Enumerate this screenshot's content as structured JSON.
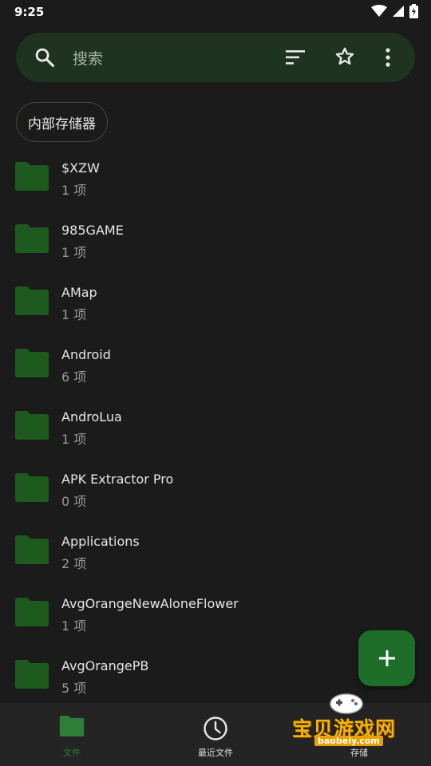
{
  "status_bar": {
    "time": "9:25"
  },
  "search": {
    "placeholder": "搜索"
  },
  "storage_chip": {
    "label": "内部存储器"
  },
  "files": [
    {
      "name": "$XZW",
      "count": "1 项"
    },
    {
      "name": "985GAME",
      "count": "1 项"
    },
    {
      "name": "AMap",
      "count": "1 项"
    },
    {
      "name": "Android",
      "count": "6 项"
    },
    {
      "name": "AndroLua",
      "count": "1 项"
    },
    {
      "name": "APK Extractor Pro",
      "count": "0 项"
    },
    {
      "name": "Applications",
      "count": "2 项"
    },
    {
      "name": "AvgOrangeNewAloneFlower",
      "count": "1 项"
    },
    {
      "name": "AvgOrangePB",
      "count": "5 项"
    }
  ],
  "bottom_nav": {
    "files_label": "文件",
    "recent_label": "最近文件",
    "storage_label": "存储"
  },
  "watermark": {
    "text": "宝贝游戏网",
    "url": "baobeiy.com"
  },
  "colors": {
    "background": "#1b1b1b",
    "search_bar": "#1e3320",
    "folder": "#1e5a1e",
    "accent": "#1e6e2a"
  },
  "icons": {
    "search": "search-icon",
    "sort": "sort-icon",
    "star": "star-outline-icon",
    "more": "more-vert-icon",
    "folder": "folder-icon",
    "add": "add-icon",
    "recent": "clock-icon"
  }
}
